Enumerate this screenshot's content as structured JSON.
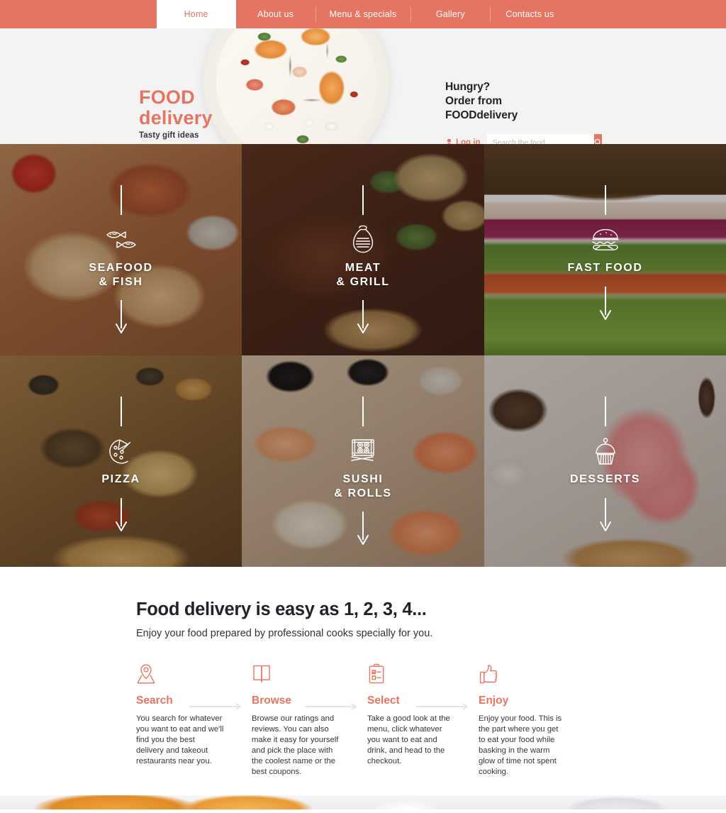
{
  "colors": {
    "accent": "#e57462",
    "accent_text": "#ea7460",
    "nav_bg": "#e57462",
    "hero_bg": "#f3f3f3",
    "dark_text": "#20232a"
  },
  "nav": {
    "items": [
      {
        "label": "Home",
        "active": true
      },
      {
        "label": "About us",
        "active": false
      },
      {
        "label": "Menu & specials",
        "active": false
      },
      {
        "label": "Gallery",
        "active": false
      },
      {
        "label": "Contacts us",
        "active": false
      }
    ]
  },
  "hero": {
    "logo_line1": "FOOD",
    "logo_line2": "delivery",
    "tagline": "Tasty gift ideas",
    "headline_line1": "Hungry?",
    "headline_line2": "Order from",
    "headline_line3": "FOODdelivery",
    "login_label": "Log in",
    "search_placeholder": "Search the food",
    "search_value": "",
    "plate_image_alt": "Plate of peach prosciutto mozzarella salad with balsamic drizzle"
  },
  "categories": [
    {
      "label_line1": "SEAFOOD",
      "label_line2": "& FISH",
      "icon": "two-fish-icon",
      "photo": "ph-seafood"
    },
    {
      "label_line1": "MEAT",
      "label_line2": "& GRILL",
      "icon": "ham-icon",
      "photo": "ph-meat"
    },
    {
      "label_line1": "FAST FOOD",
      "label_line2": "",
      "icon": "burger-icon",
      "photo": "ph-fastfood"
    },
    {
      "label_line1": "PIZZA",
      "label_line2": "",
      "icon": "pizza-slice-icon",
      "photo": "ph-pizza"
    },
    {
      "label_line1": "SUSHI",
      "label_line2": "& ROLLS",
      "icon": "sushi-tray-icon",
      "photo": "ph-sushi"
    },
    {
      "label_line1": "DESSERTS",
      "label_line2": "",
      "icon": "cupcake-icon",
      "photo": "ph-desserts"
    }
  ],
  "steps_section": {
    "title": "Food delivery is easy as 1, 2, 3, 4...",
    "subtitle": "Enjoy your food prepared by professional cooks specially for you.",
    "steps": [
      {
        "name": "Search",
        "icon": "map-pin-icon",
        "text": "You search for whatever you want to eat and we'll find you the best delivery and takeout restaurants near you."
      },
      {
        "name": "Browse",
        "icon": "open-book-icon",
        "text": "Browse our ratings and reviews. You can also make it easy for yourself and pick the place with the coolest name or the best coupons."
      },
      {
        "name": "Select",
        "icon": "clipboard-checklist-icon",
        "text": "Take a good look at the menu, click whatever you want to eat and drink, and head to the checkout."
      },
      {
        "name": "Enjoy",
        "icon": "thumbs-up-icon",
        "text": "Enjoy your food. This is the part where you get to eat your food while basking in the warm glow of time not spent cooking."
      }
    ]
  }
}
